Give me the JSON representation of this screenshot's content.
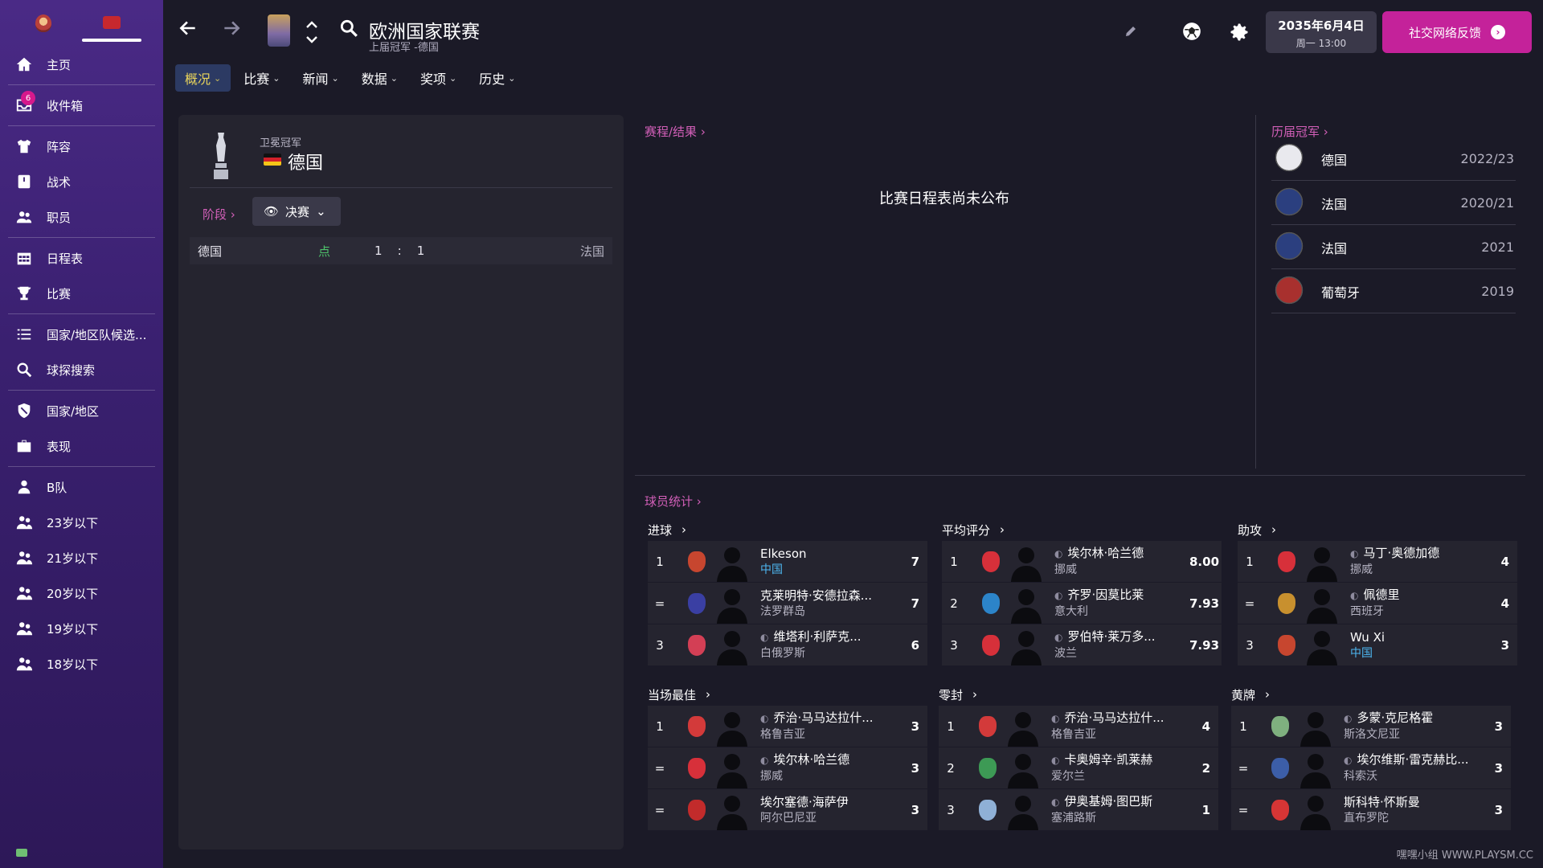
{
  "sidebar": {
    "inbox_badge": "6",
    "items": [
      {
        "label": "主页",
        "icon": "home-icon"
      },
      {
        "label": "收件箱",
        "icon": "inbox-icon"
      },
      {
        "label": "阵容",
        "icon": "shirt-icon"
      },
      {
        "label": "战术",
        "icon": "tactics-icon"
      },
      {
        "label": "职员",
        "icon": "staff-icon"
      },
      {
        "label": "日程表",
        "icon": "calendar-icon"
      },
      {
        "label": "比赛",
        "icon": "trophy-icon"
      },
      {
        "label": "国家/地区队候选...",
        "icon": "list-icon"
      },
      {
        "label": "球探搜索",
        "icon": "search-icon"
      },
      {
        "label": "国家/地区",
        "icon": "shield-icon"
      },
      {
        "label": "表现",
        "icon": "briefcase-icon"
      },
      {
        "label": "B队",
        "icon": "team-icon"
      },
      {
        "label": "23岁以下",
        "icon": "youth-team-icon"
      },
      {
        "label": "21岁以下",
        "icon": "youth-team-icon"
      },
      {
        "label": "20岁以下",
        "icon": "youth-team-icon"
      },
      {
        "label": "19岁以下",
        "icon": "youth-team-icon"
      },
      {
        "label": "18岁以下",
        "icon": "youth-team-icon"
      }
    ]
  },
  "header": {
    "title": "欧洲国家联赛",
    "subtitle": "上届冠军 -德国",
    "date_line1": "2035年6月4日",
    "date_line2": "周一 13:00",
    "feedback_label": "社交网络反馈"
  },
  "tabs": [
    {
      "label": "概况",
      "active": true
    },
    {
      "label": "比赛",
      "active": false
    },
    {
      "label": "新闻",
      "active": false
    },
    {
      "label": "数据",
      "active": false
    },
    {
      "label": "奖项",
      "active": false
    },
    {
      "label": "历史",
      "active": false
    }
  ],
  "holder": {
    "label": "卫冕冠军",
    "name": "德国",
    "stage_link": "阶段",
    "stage_value": "决赛",
    "result": {
      "home": "德国",
      "note": "点",
      "home_score": "1",
      "sep": ":",
      "away_score": "1",
      "away": "法国"
    }
  },
  "fixtures": {
    "link": "赛程/结果",
    "empty_text": "比赛日程表尚未公布"
  },
  "champions": {
    "link": "历届冠军",
    "rows": [
      {
        "name": "德国",
        "year": "2022/23",
        "color": "#e9e9ee"
      },
      {
        "name": "法国",
        "year": "2020/21",
        "color": "#2b3f7f"
      },
      {
        "name": "法国",
        "year": "2021",
        "color": "#2b3f7f"
      },
      {
        "name": "葡萄牙",
        "year": "2019",
        "color": "#a8302e"
      }
    ]
  },
  "stats": {
    "link": "球员统计",
    "blocks": [
      {
        "title": "进球",
        "rows": [
          {
            "rank": "1",
            "name": "Elkeson",
            "nat": "中国",
            "value": "7",
            "locked": false,
            "club": "#c7462f"
          },
          {
            "rank": "=",
            "name": "克莱明特·安德拉森...",
            "nat": "法罗群岛",
            "value": "7",
            "locked": false,
            "club": "#3a3fa3"
          },
          {
            "rank": "3",
            "name": "维塔利·利萨克...",
            "nat": "白俄罗斯",
            "value": "6",
            "locked": true,
            "club": "#d33f55"
          }
        ]
      },
      {
        "title": "平均评分",
        "rows": [
          {
            "rank": "1",
            "name": "埃尔林·哈兰德",
            "nat": "挪威",
            "value": "8.00",
            "locked": true,
            "club": "#d7303a"
          },
          {
            "rank": "2",
            "name": "齐罗·因莫比莱",
            "nat": "意大利",
            "value": "7.93",
            "locked": true,
            "club": "#2c84c9"
          },
          {
            "rank": "3",
            "name": "罗伯特·莱万多...",
            "nat": "波兰",
            "value": "7.93",
            "locked": true,
            "club": "#d6303a"
          }
        ]
      },
      {
        "title": "助攻",
        "rows": [
          {
            "rank": "1",
            "name": "马丁·奥德加德",
            "nat": "挪威",
            "value": "4",
            "locked": true,
            "club": "#d7303a"
          },
          {
            "rank": "=",
            "name": "佩德里",
            "nat": "西班牙",
            "value": "4",
            "locked": true,
            "club": "#c8902e"
          },
          {
            "rank": "3",
            "name": "Wu Xi",
            "nat": "中国",
            "value": "3",
            "locked": false,
            "club": "#c7462f"
          }
        ]
      },
      {
        "title": "当场最佳",
        "rows": [
          {
            "rank": "1",
            "name": "乔治·马马达拉什...",
            "nat": "格鲁吉亚",
            "value": "3",
            "locked": true,
            "club": "#d33a3a"
          },
          {
            "rank": "=",
            "name": "埃尔林·哈兰德",
            "nat": "挪威",
            "value": "3",
            "locked": true,
            "club": "#d7303a"
          },
          {
            "rank": "=",
            "name": "埃尔塞德·海萨伊",
            "nat": "阿尔巴尼亚",
            "value": "3",
            "locked": false,
            "club": "#c22b2b"
          }
        ]
      },
      {
        "title": "零封",
        "rows": [
          {
            "rank": "1",
            "name": "乔治·马马达拉什...",
            "nat": "格鲁吉亚",
            "value": "4",
            "locked": true,
            "club": "#d33a3a"
          },
          {
            "rank": "2",
            "name": "卡奥姆辛·凯莱赫",
            "nat": "爱尔兰",
            "value": "2",
            "locked": true,
            "club": "#3d9a55"
          },
          {
            "rank": "3",
            "name": "伊奥基姆·图巴斯",
            "nat": "塞浦路斯",
            "value": "1",
            "locked": true,
            "club": "#8fb0d6"
          }
        ]
      },
      {
        "title": "黄牌",
        "rows": [
          {
            "rank": "1",
            "name": "多蒙·克尼格霍",
            "nat": "斯洛文尼亚",
            "value": "3",
            "locked": true,
            "club": "#7fb07f"
          },
          {
            "rank": "=",
            "name": "埃尔维斯·雷克赫比...",
            "nat": "科索沃",
            "value": "3",
            "locked": true,
            "club": "#3c5ea8"
          },
          {
            "rank": "=",
            "name": "斯科特·怀斯曼",
            "nat": "直布罗陀",
            "value": "3",
            "locked": false,
            "club": "#d63535"
          }
        ]
      }
    ]
  },
  "watermark": "嘿嘿小组 WWW.PLAYSM.CC"
}
